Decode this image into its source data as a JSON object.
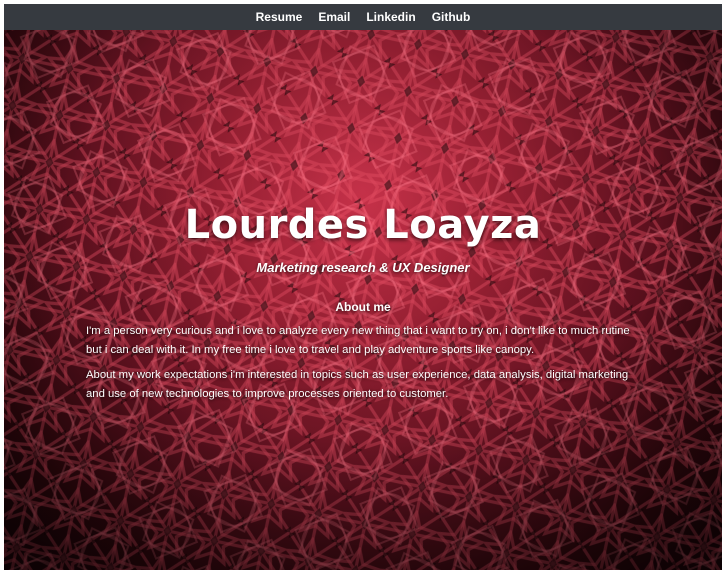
{
  "nav": {
    "links": [
      "Resume",
      "Email",
      "Linkedin",
      "Github"
    ]
  },
  "hero": {
    "name": "Lourdes Loayza",
    "role": "Marketing research & UX Designer",
    "about_heading": "About me",
    "about_paragraph_1": "I'm a person very curious and i love to analyze every new thing that i want to try on, i don't like to much rutine but i can deal with it. In my free time i love to travel and play adventure sports like canopy.",
    "about_paragraph_2": "About my work expectations i'm interested in topics such as user experience, data analysis, digital marketing and use of new technologies to improve processes oriented to customer."
  },
  "colors": {
    "navbar_bg": "#363a40",
    "hero_accent": "#c8324a",
    "text": "#ffffff"
  }
}
